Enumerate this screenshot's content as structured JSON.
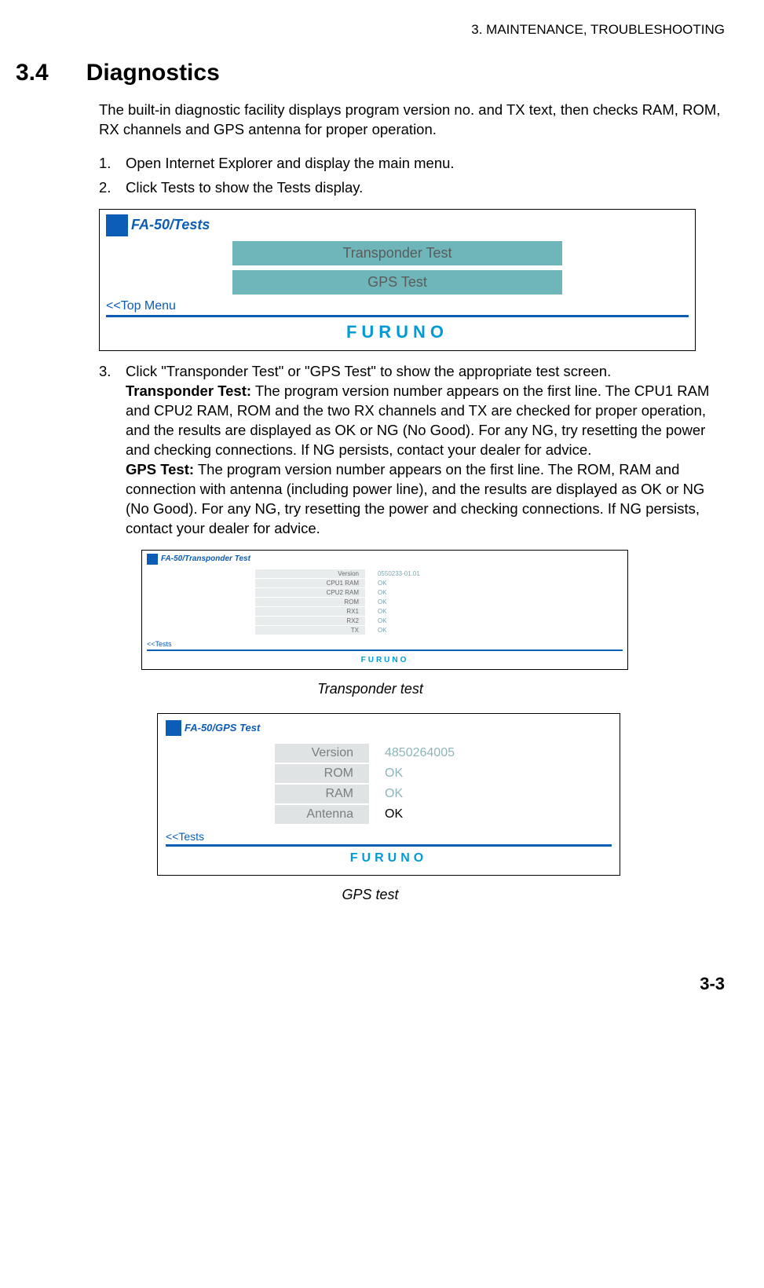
{
  "header": "3.  MAINTENANCE, TROUBLESHOOTING",
  "section": {
    "num": "3.4",
    "title": "Diagnostics"
  },
  "intro": "The built-in diagnostic facility displays program version no. and TX text, then checks RAM, ROM, RX channels and GPS antenna for proper operation.",
  "steps": {
    "s1": {
      "n": "1.",
      "t": "Open Internet Explorer and display the main menu."
    },
    "s2": {
      "n": "2.",
      "t": "Click Tests to show the Tests display."
    },
    "s3": {
      "n": "3.",
      "lead": "Click \"Transponder Test\" or \"GPS Test\" to show the appropriate test screen.",
      "tt_label": "Transponder Test:",
      "tt_body": " The program version number appears on the first line. The CPU1 RAM and CPU2 RAM, ROM and the two RX channels and TX are checked for proper operation, and the results are displayed as OK or NG (No Good). For any NG, try resetting the power and checking connections. If NG persists, contact your dealer for advice.",
      "gt_label": "GPS Test:",
      "gt_body": " The program version number appears on the first line. The ROM, RAM and connection with antenna (including power line), and the results are displayed as OK or NG (No Good). For any NG, try resetting the power and checking connections. If NG persists, contact your dealer for advice."
    }
  },
  "tests_panel": {
    "crumb": "FA-50/Tests",
    "btn1": "Transponder Test",
    "btn2": "GPS Test",
    "back": "<<Top Menu",
    "logo": "FURUNO"
  },
  "transponder_panel": {
    "crumb": "FA-50/Transponder Test",
    "rows": [
      {
        "k": "Version",
        "v": "0550233-01.01"
      },
      {
        "k": "CPU1 RAM",
        "v": "OK"
      },
      {
        "k": "CPU2 RAM",
        "v": "OK"
      },
      {
        "k": "ROM",
        "v": "OK"
      },
      {
        "k": "RX1",
        "v": "OK"
      },
      {
        "k": "RX2",
        "v": "OK"
      },
      {
        "k": "TX",
        "v": "OK"
      }
    ],
    "back": "<<Tests",
    "logo": "FURUNO",
    "caption": "Transponder test"
  },
  "gps_panel": {
    "crumb": "FA-50/GPS Test",
    "rows": [
      {
        "k": "Version",
        "v": "4850264005"
      },
      {
        "k": "ROM",
        "v": "OK"
      },
      {
        "k": "RAM",
        "v": "OK"
      },
      {
        "k": "Antenna",
        "v": "OK"
      }
    ],
    "back": "<<Tests",
    "logo": "FURUNO",
    "caption": "GPS test"
  },
  "page_num": "3-3"
}
